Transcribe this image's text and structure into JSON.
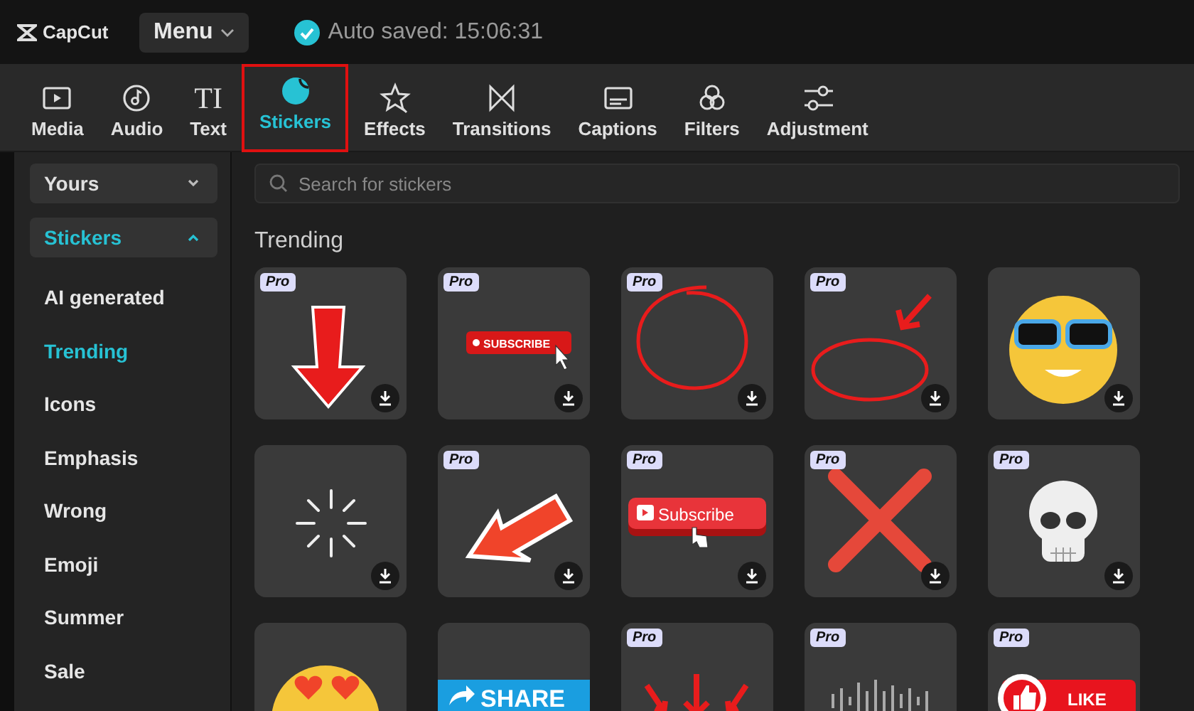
{
  "app": {
    "logo": "CapCut",
    "menu_button": "Menu",
    "save_status": "Auto saved: 15:06:31"
  },
  "tabs": [
    {
      "label": "Media",
      "kind": "media",
      "selected": false,
      "highlighted": false
    },
    {
      "label": "Audio",
      "kind": "audio",
      "selected": false,
      "highlighted": false
    },
    {
      "label": "Text",
      "kind": "text",
      "icon_text": "TI",
      "selected": false,
      "highlighted": false
    },
    {
      "label": "Stickers",
      "kind": "stickers",
      "selected": true,
      "highlighted": true
    },
    {
      "label": "Effects",
      "kind": "effects",
      "selected": false,
      "highlighted": false
    },
    {
      "label": "Transitions",
      "kind": "transitions",
      "selected": false,
      "highlighted": false
    },
    {
      "label": "Captions",
      "kind": "captions",
      "selected": false,
      "highlighted": false
    },
    {
      "label": "Filters",
      "kind": "filters",
      "selected": false,
      "highlighted": false
    },
    {
      "label": "Adjustment",
      "kind": "adjustment",
      "selected": false,
      "highlighted": false
    }
  ],
  "sidebar": {
    "groups": [
      {
        "label": "Yours",
        "expanded": false,
        "selected": false
      },
      {
        "label": "Stickers",
        "expanded": true,
        "selected": true
      }
    ],
    "items": [
      {
        "label": "AI generated",
        "selected": false
      },
      {
        "label": "Trending",
        "selected": true
      },
      {
        "label": "Icons",
        "selected": false
      },
      {
        "label": "Emphasis",
        "selected": false
      },
      {
        "label": "Wrong",
        "selected": false
      },
      {
        "label": "Emoji",
        "selected": false
      },
      {
        "label": "Summer",
        "selected": false
      },
      {
        "label": "Sale",
        "selected": false
      }
    ]
  },
  "search": {
    "placeholder": "Search for stickers"
  },
  "section_title": "Trending",
  "tiles": [
    {
      "kind": "arrow-down",
      "badge": "Pro"
    },
    {
      "kind": "subscribe-bar",
      "badge": "Pro",
      "text": "SUBSCRIBE"
    },
    {
      "kind": "circle",
      "badge": "Pro"
    },
    {
      "kind": "circle-arrow",
      "badge": "Pro"
    },
    {
      "kind": "sunglasses-emoji"
    },
    {
      "kind": "burst"
    },
    {
      "kind": "arrow-left",
      "badge": "Pro"
    },
    {
      "kind": "subscribe-button",
      "badge": "Pro",
      "text": "Subscribe"
    },
    {
      "kind": "cross",
      "badge": "Pro"
    },
    {
      "kind": "skull",
      "badge": "Pro"
    },
    {
      "kind": "heart-eyes-emoji"
    },
    {
      "kind": "share-button",
      "text": "SHARE"
    },
    {
      "kind": "arrows-down",
      "badge": "Pro"
    },
    {
      "kind": "audio-wave",
      "badge": "Pro"
    },
    {
      "kind": "like-button",
      "badge": "Pro",
      "text": "LIKE"
    }
  ]
}
